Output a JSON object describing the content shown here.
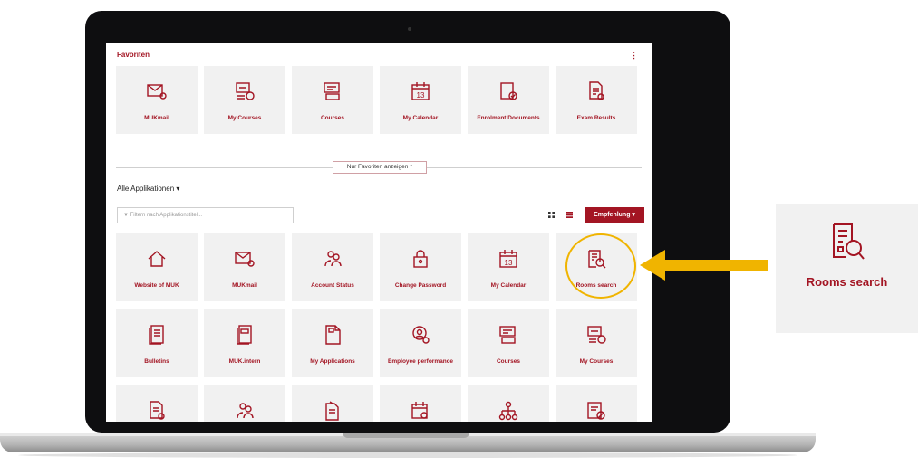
{
  "favorites": {
    "title": "Favoriten",
    "menu_icon": "kebab-icon",
    "tiles": [
      {
        "label": "MUKmail",
        "icon": "mail-icon"
      },
      {
        "label": "My Courses",
        "icon": "courses-info-icon"
      },
      {
        "label": "Courses",
        "icon": "courses-icon"
      },
      {
        "label": "My Calendar",
        "icon": "calendar-icon"
      },
      {
        "label": "Enrolment Documents",
        "icon": "enrolment-document-icon"
      },
      {
        "label": "Exam Results",
        "icon": "exam-results-icon"
      }
    ],
    "toggle_button": "Nur Favoriten anzeigen ^"
  },
  "all_apps": {
    "title": "Alle Applikationen  ▾",
    "filter_placeholder": "Filtern nach Applikationstitel...",
    "sort_button": "Empfehlung ▾",
    "tiles": [
      {
        "label": "Website of MUK",
        "icon": "home-icon",
        "starred": false
      },
      {
        "label": "MUKmail",
        "icon": "mail-icon",
        "starred": true
      },
      {
        "label": "Account Status",
        "icon": "account-status-icon",
        "starred": false
      },
      {
        "label": "Change Password",
        "icon": "lock-icon",
        "starred": false
      },
      {
        "label": "My Calendar",
        "icon": "calendar-icon",
        "starred": true
      },
      {
        "label": "Rooms search",
        "icon": "rooms-search-icon",
        "starred": false
      },
      {
        "label": "Bulletins",
        "icon": "bulletins-icon",
        "starred": false
      },
      {
        "label": "MUK.intern",
        "icon": "intern-icon",
        "starred": false
      },
      {
        "label": "My Applications",
        "icon": "applications-icon",
        "starred": false
      },
      {
        "label": "Employee performance",
        "icon": "employee-performance-icon",
        "starred": false
      },
      {
        "label": "Courses",
        "icon": "courses-icon",
        "starred": true
      },
      {
        "label": "My Courses",
        "icon": "courses-info-icon",
        "starred": true
      },
      {
        "label": "",
        "icon": "document-gear-icon",
        "starred": true
      },
      {
        "label": "",
        "icon": "people-icon",
        "starred": false
      },
      {
        "label": "",
        "icon": "document-hand-icon",
        "starred": false
      },
      {
        "label": "",
        "icon": "calendar-search-icon",
        "starred": false
      },
      {
        "label": "",
        "icon": "org-chart-icon",
        "starred": false
      },
      {
        "label": "",
        "icon": "card-blocked-icon",
        "starred": false
      }
    ]
  },
  "callout": {
    "label": "Rooms search",
    "icon": "rooms-search-icon",
    "highlight_color": "#f0b400"
  },
  "colors": {
    "accent": "#a31523",
    "tile_bg": "#f1f1f1"
  }
}
